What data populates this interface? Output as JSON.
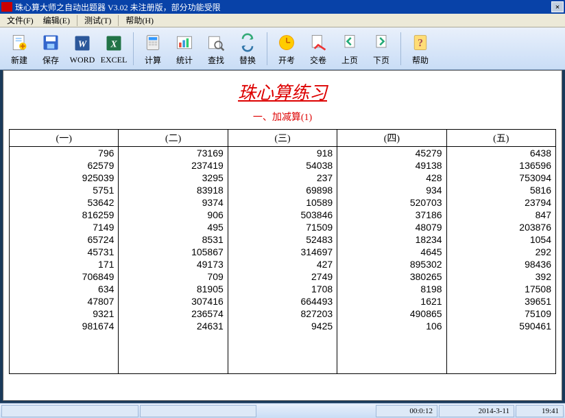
{
  "title": "珠心算大师之自动出题器 V3.02 未注册版，部分功能受限",
  "menus": {
    "file": "文件(F)",
    "edit": "编辑(E)",
    "test": "测试(T)",
    "help": "帮助(H)"
  },
  "tools": {
    "new": "新建",
    "save": "保存",
    "word": "WORD",
    "excel": "EXCEL",
    "calc": "计算",
    "stat": "统计",
    "find": "查找",
    "replace": "替换",
    "start": "开考",
    "submit": "交卷",
    "prev": "上页",
    "next": "下页",
    "thelp": "帮助"
  },
  "doc": {
    "title": "珠心算练习",
    "subtitle": "一、加减算(1)"
  },
  "headers": [
    "(一)",
    "(二)",
    "(三)",
    "(四)",
    "(五)"
  ],
  "rows": [
    [
      "796",
      "73169",
      "918",
      "45279",
      "6438"
    ],
    [
      "62579",
      "237419",
      "54038",
      "49138",
      "136596"
    ],
    [
      "925039",
      "3295",
      "237",
      "428",
      "753094"
    ],
    [
      "5751",
      "83918",
      "69898",
      "934",
      "5816"
    ],
    [
      "53642",
      "9374",
      "10589",
      "520703",
      "23794"
    ],
    [
      "816259",
      "906",
      "503846",
      "37186",
      "847"
    ],
    [
      "7149",
      "495",
      "71509",
      "48079",
      "203876"
    ],
    [
      "65724",
      "8531",
      "52483",
      "18234",
      "1054"
    ],
    [
      "45731",
      "105867",
      "314697",
      "4645",
      "292"
    ],
    [
      "171",
      "49173",
      "427",
      "895302",
      "98436"
    ],
    [
      "706849",
      "709",
      "2749",
      "380265",
      "392"
    ],
    [
      "634",
      "81905",
      "1708",
      "8198",
      "17508"
    ],
    [
      "47807",
      "307416",
      "664493",
      "1621",
      "39651"
    ],
    [
      "9321",
      "236574",
      "827203",
      "490865",
      "75109"
    ],
    [
      "981674",
      "24631",
      "9425",
      "106",
      "590461"
    ]
  ],
  "status": {
    "elapsed": "00:0:12",
    "date": "2014-3-11",
    "time": "19:41"
  }
}
